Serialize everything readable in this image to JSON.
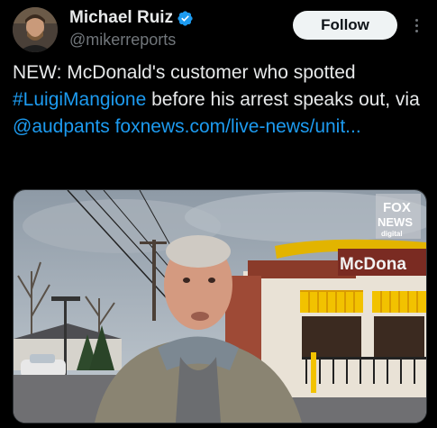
{
  "author": {
    "display_name": "Michael Ruiz",
    "handle": "@mikerreports",
    "verified": true,
    "avatar_icon": "avatar-photo"
  },
  "actions": {
    "follow_label": "Follow",
    "more_icon": "more-vertical-icon"
  },
  "tweet": {
    "text_prefix": "NEW: McDonald's customer who spotted ",
    "hashtag": "#LuigiMangione",
    "text_middle": " before his arrest speaks out, via ",
    "mention": "@audpants",
    "url": "foxnews.com/live-news/unit..."
  },
  "media": {
    "logo_line1": "FOX",
    "logo_line2": "NEWS",
    "logo_line3": "digital",
    "store_sign": "McDona"
  },
  "colors": {
    "link": "#1d9bf0",
    "verified": "#1d9bf0",
    "background": "#000000"
  }
}
